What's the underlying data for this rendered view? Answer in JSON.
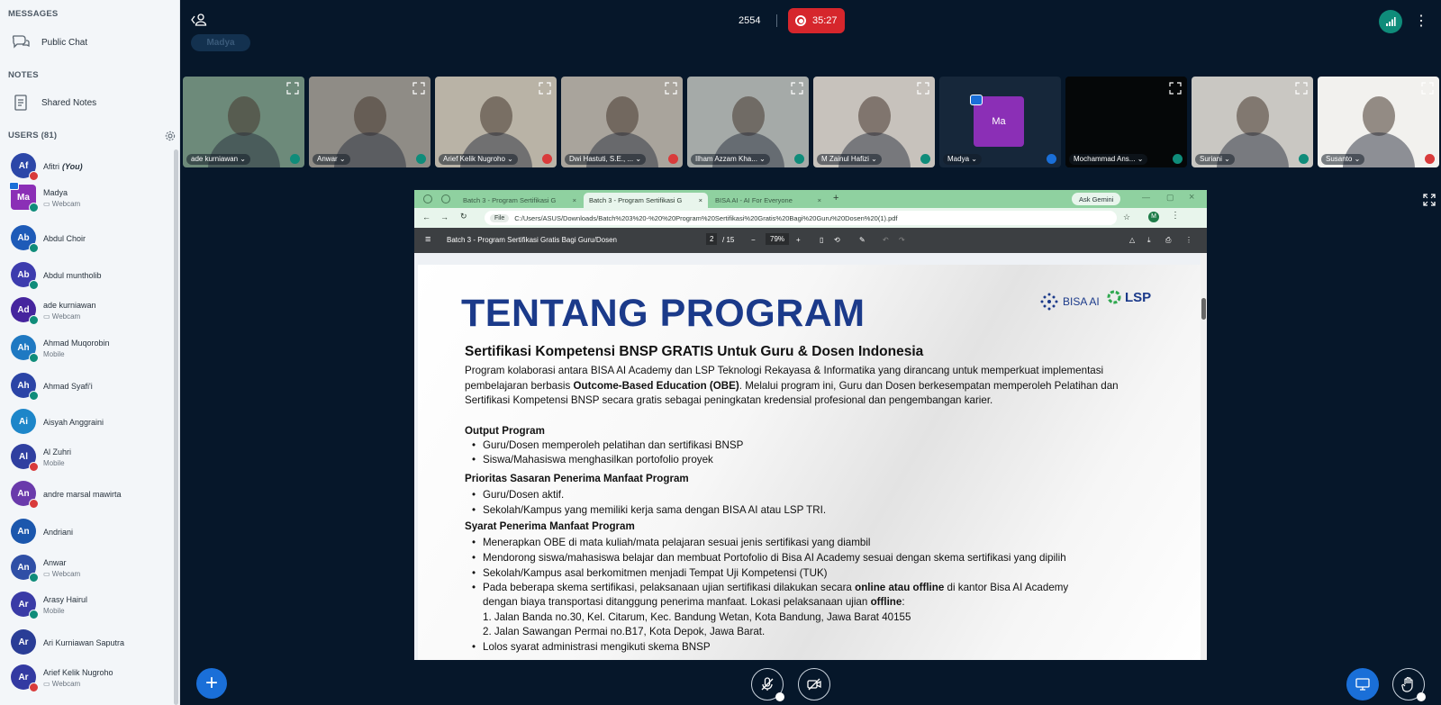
{
  "sidebar": {
    "messages_title": "MESSAGES",
    "public_chat": "Public Chat",
    "notes_title": "NOTES",
    "shared_notes": "Shared Notes",
    "users_title": "USERS (81)",
    "users": [
      {
        "initials": "Af",
        "name": "Afitri",
        "you": "(You)",
        "sub": "",
        "color": "#2c47a8",
        "badge": "red",
        "square": false,
        "presenter": false
      },
      {
        "initials": "Ma",
        "name": "Madya",
        "sub": "Webcam",
        "color": "#8b2fb6",
        "badge": "green",
        "square": true,
        "presenter": true
      },
      {
        "initials": "Ab",
        "name": "Abdul Choir",
        "sub": "",
        "color": "#1e5bb8",
        "badge": "green"
      },
      {
        "initials": "Ab",
        "name": "Abdul muntholib",
        "sub": "",
        "color": "#3d3cae",
        "badge": "green"
      },
      {
        "initials": "Ad",
        "name": "ade kurniawan",
        "sub": "Webcam",
        "color": "#46259e",
        "badge": "green"
      },
      {
        "initials": "Ah",
        "name": "Ahmad Muqorobin",
        "sub": "Mobile",
        "color": "#1f79c2",
        "badge": "green"
      },
      {
        "initials": "Ah",
        "name": "Ahmad Syafi'i",
        "sub": "",
        "color": "#2b44a6",
        "badge": "green"
      },
      {
        "initials": "Ai",
        "name": "Aisyah Anggraini",
        "sub": "",
        "color": "#1d86c9",
        "badge": ""
      },
      {
        "initials": "Al",
        "name": "Al Zuhri",
        "sub": "Mobile",
        "color": "#2f3fa0",
        "badge": "red"
      },
      {
        "initials": "An",
        "name": "andre marsal mawirta",
        "sub": "",
        "color": "#6a3aab",
        "badge": "red"
      },
      {
        "initials": "An",
        "name": "Andriani",
        "sub": "",
        "color": "#1b57ad",
        "badge": ""
      },
      {
        "initials": "An",
        "name": "Anwar",
        "sub": "Webcam",
        "color": "#2f4fa6",
        "badge": "green"
      },
      {
        "initials": "Ar",
        "name": "Arasy Hairul",
        "sub": "Mobile",
        "color": "#3a3ba6",
        "badge": "green"
      },
      {
        "initials": "Ar",
        "name": "Ari Kurniawan Saputra",
        "sub": "",
        "color": "#2a3d96",
        "badge": ""
      },
      {
        "initials": "Ar",
        "name": "Arief Kelik Nugroho",
        "sub": "Webcam",
        "color": "#333aa2",
        "badge": "red"
      }
    ]
  },
  "topbar": {
    "presenter_chip": "Madya",
    "meeting_id": "2554",
    "rec_time": "35:27"
  },
  "videos": [
    {
      "name": "ade kurniawan",
      "mic": "green",
      "bg": "#6d8a7a",
      "avatar": ""
    },
    {
      "name": "Anwar",
      "mic": "green",
      "bg": "#8f8c86",
      "avatar": ""
    },
    {
      "name": "Arief Kelik Nugroho",
      "mic": "red",
      "bg": "#b9b3a6",
      "avatar": ""
    },
    {
      "name": "Dwi Hastuti, S.E., ...",
      "mic": "red",
      "bg": "#a9a49c",
      "avatar": ""
    },
    {
      "name": "Ilham Azzam Kha...",
      "mic": "green",
      "bg": "#a5aaa8",
      "avatar": ""
    },
    {
      "name": "M Zainul Hafizi",
      "mic": "green",
      "bg": "#c7c2bc",
      "avatar": ""
    },
    {
      "name": "Madya",
      "mic": "blue",
      "bg": "#16273a",
      "avatar": "Ma"
    },
    {
      "name": "Mochammad Ans...",
      "mic": "green",
      "bg": "#050708",
      "avatar": ""
    },
    {
      "name": "Suriani",
      "mic": "green",
      "bg": "#c9c7c2",
      "avatar": ""
    },
    {
      "name": "Susanto",
      "mic": "red",
      "bg": "#f2f1ee",
      "avatar": ""
    }
  ],
  "browser": {
    "tabs": [
      "Batch 3 - Program Sertifikasi G",
      "Batch 3 - Program Sertifikasi G",
      "BISA AI - AI For Everyone"
    ],
    "ask_gemini": "Ask Gemini",
    "url_file": "File",
    "url": "C:/Users/ASUS/Downloads/Batch%203%20-%20%20Program%20Sertifikasi%20Gratis%20Bagi%20Guru%20Dosen%20(1).pdf"
  },
  "pdf": {
    "title": "Batch 3 - Program Sertifikasi Gratis Bagi Guru/Dosen",
    "page": "2",
    "total": "/ 15",
    "zoom": "79%"
  },
  "doc": {
    "heading": "TENTANG PROGRAM",
    "logo1": "BISA AI",
    "logo2": "LSP",
    "subheading": "Sertifikasi Kompetensi BNSP GRATIS Untuk Guru & Dosen Indonesia",
    "intro_1": "Program kolaborasi antara BISA AI Academy dan LSP Teknologi Rekayasa & Informatika yang dirancang untuk memperkuat implementasi pembelajaran berbasis ",
    "intro_bold": "Outcome-Based Education (OBE)",
    "intro_2": ". Melalui program ini, Guru dan Dosen berkesempatan memperoleh Pelatihan dan Sertifikasi Kompetensi BNSP secara gratis sebagai peningkatan kredensial profesional dan pengembangan karier.",
    "output_title": "Output Program",
    "output_items": [
      "Guru/Dosen memperoleh pelatihan dan sertifikasi BNSP",
      "Siswa/Mahasiswa menghasilkan portofolio proyek"
    ],
    "priority_title": "Prioritas Sasaran Penerima Manfaat Program",
    "priority_items": [
      "Guru/Dosen aktif.",
      "Sekolah/Kampus yang memiliki kerja sama dengan BISA AI atau LSP TRI."
    ],
    "req_title": "Syarat Penerima Manfaat Program",
    "req_items": [
      "Menerapkan OBE di mata kuliah/mata pelajaran sesuai jenis sertifikasi yang diambil",
      "Mendorong siswa/mahasiswa belajar dan membuat Portofolio di Bisa AI Academy sesuai dengan skema sertifikasi yang dipilih",
      "Sekolah/Kampus asal berkomitmen menjadi Tempat Uji Kompetensi (TUK)"
    ],
    "req4_a": "Pada beberapa skema sertifikasi, pelaksanaan ujian sertifikasi dilakukan secara ",
    "req4_b": "online atau offline",
    "req4_c": " di kantor Bisa AI Academy",
    "req4_d": "dengan biaya transportasi ditanggung penerima manfaat. Lokasi pelaksanaan ujian ",
    "req4_e": "offline",
    "req4_f": ":",
    "addr1": "1. Jalan Banda no.30, Kel. Citarum, Kec. Bandung Wetan, Kota Bandung, Jawa Barat 40155",
    "addr2": "2. Jalan Sawangan Permai no.B17, Kota Depok, Jawa Barat.",
    "req_last": "Lolos syarat administrasi mengikuti skema BNSP"
  }
}
